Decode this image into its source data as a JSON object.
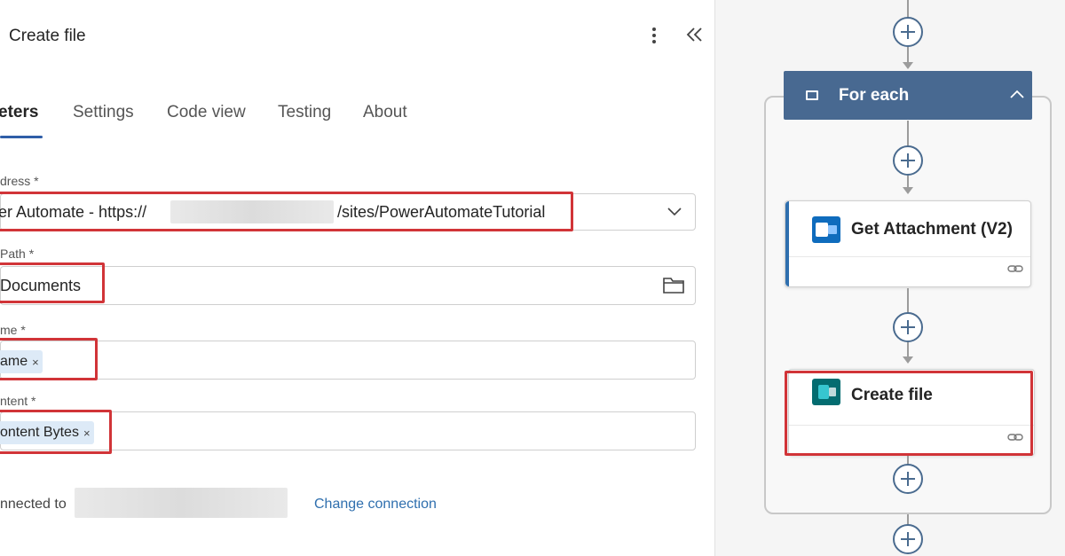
{
  "panel": {
    "title": "Create file",
    "tabs": [
      {
        "label": "eters"
      },
      {
        "label": "Settings"
      },
      {
        "label": "Code view"
      },
      {
        "label": "Testing"
      },
      {
        "label": "About"
      }
    ],
    "fields": {
      "site_address": {
        "label": "dress *",
        "value_prefix": "er Automate - https://",
        "value_suffix": "/sites/PowerAutomateTutorial"
      },
      "folder_path": {
        "label": "Path *",
        "value": "Documents"
      },
      "file_name": {
        "label": "me *",
        "token": "ame",
        "token_remove": "×"
      },
      "file_content": {
        "label": "ntent *",
        "token": "ontent Bytes",
        "token_remove": "×"
      }
    },
    "connection": {
      "label": "nnected to",
      "change_link": "Change connection"
    }
  },
  "canvas": {
    "foreach": {
      "title": "For each"
    },
    "actions": [
      {
        "title": "Get Attachment (V2)",
        "icon": "outlook-icon"
      },
      {
        "title": "Create file",
        "icon": "sharepoint-icon"
      }
    ]
  },
  "colors": {
    "accent_blue": "#2f5ea8",
    "foreach_header": "#486991",
    "highlight_red": "#d13438",
    "token_bg": "#ddeaf7",
    "link_blue": "#2f6fae"
  }
}
